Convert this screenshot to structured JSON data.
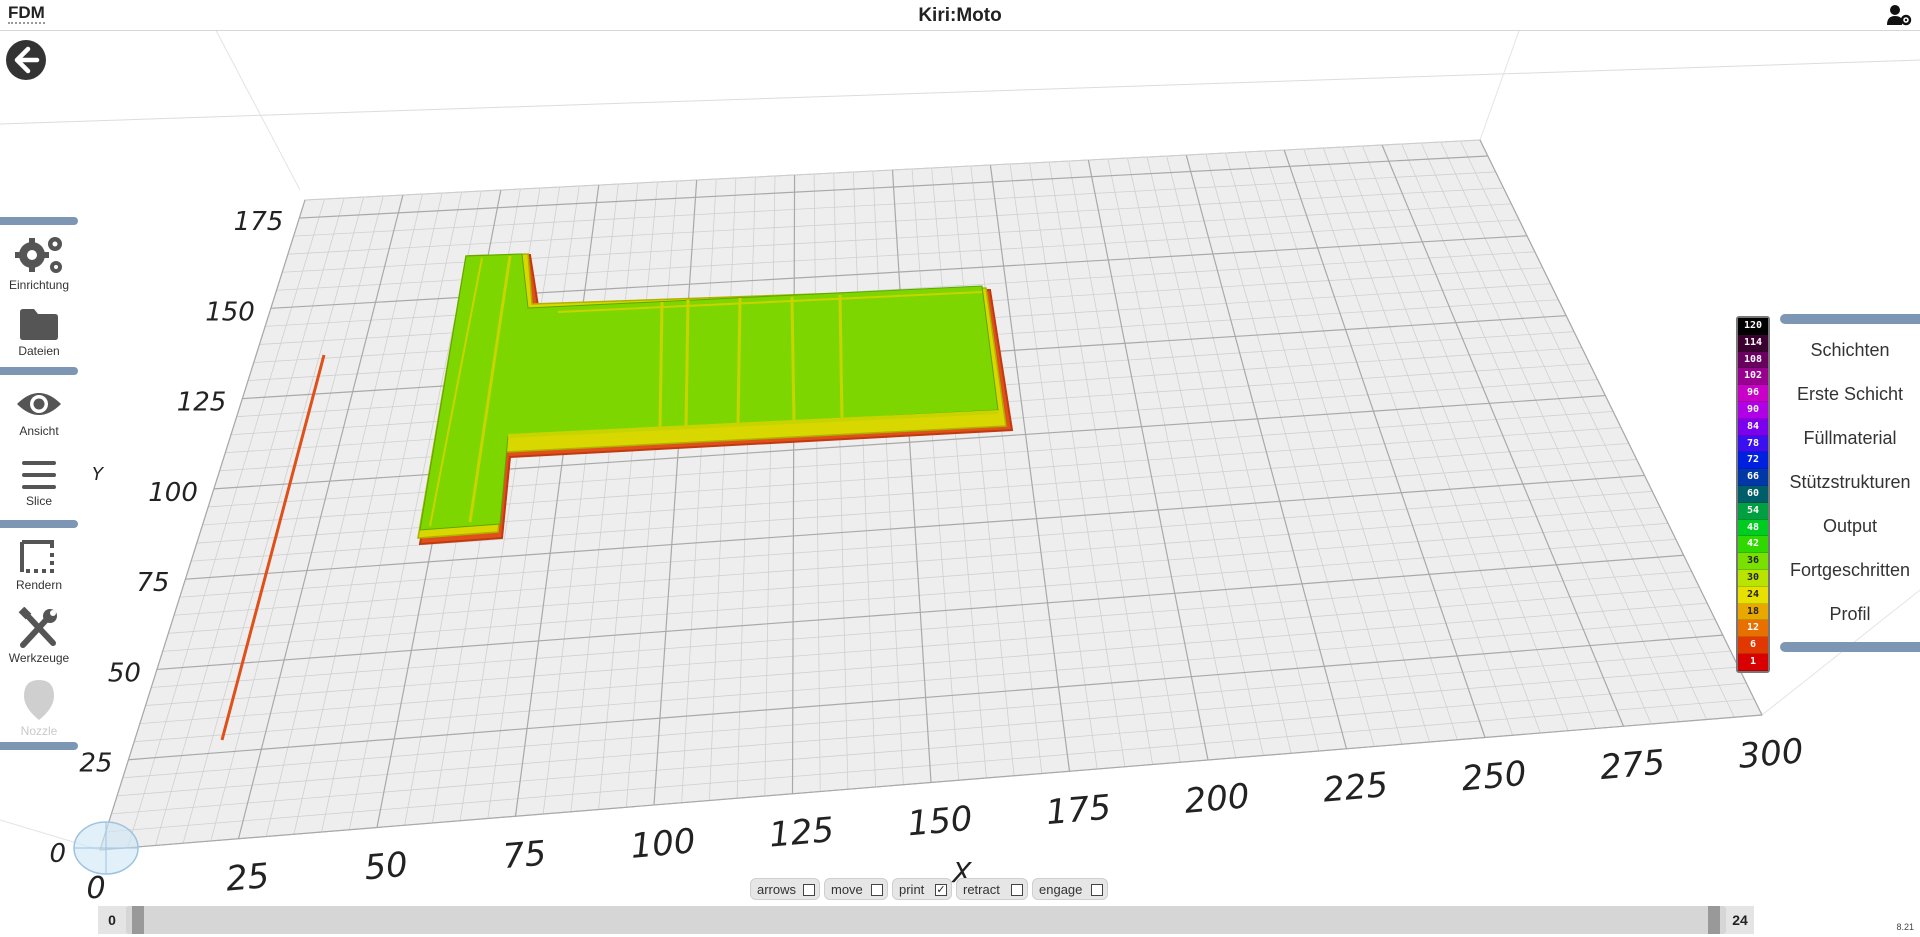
{
  "header": {
    "mode": "FDM",
    "title": "Kiri:Moto"
  },
  "sidebar": {
    "items": [
      {
        "label": "Einrichtung",
        "icon": "gears-icon"
      },
      {
        "label": "Dateien",
        "icon": "folder-icon"
      },
      {
        "label": "Ansicht",
        "icon": "eye-icon"
      },
      {
        "label": "Slice",
        "icon": "menu-icon"
      },
      {
        "label": "Rendern",
        "icon": "render-icon"
      },
      {
        "label": "Werkzeuge",
        "icon": "tools-icon"
      },
      {
        "label": "Nozzle",
        "icon": "nozzle-icon",
        "disabled": true
      }
    ]
  },
  "right_panel": {
    "items": [
      "Schichten",
      "Erste Schicht",
      "Füllmaterial",
      "Stützstrukturen",
      "Output",
      "Fortgeschritten",
      "Profil"
    ]
  },
  "legend": {
    "entries": [
      {
        "value": "120",
        "color": "#000000"
      },
      {
        "value": "114",
        "color": "#3a0030"
      },
      {
        "value": "108",
        "color": "#6a0060"
      },
      {
        "value": "102",
        "color": "#9a0090"
      },
      {
        "value": "96",
        "color": "#c800c8"
      },
      {
        "value": "90",
        "color": "#b000e6"
      },
      {
        "value": "84",
        "color": "#7a00ee"
      },
      {
        "value": "78",
        "color": "#3a10f0"
      },
      {
        "value": "72",
        "color": "#0020e0"
      },
      {
        "value": "66",
        "color": "#0038a8"
      },
      {
        "value": "60",
        "color": "#005e6a"
      },
      {
        "value": "54",
        "color": "#00a040"
      },
      {
        "value": "48",
        "color": "#00cc20"
      },
      {
        "value": "42",
        "color": "#30d800"
      },
      {
        "value": "36",
        "color": "#7ae000"
      },
      {
        "value": "30",
        "color": "#b8e400"
      },
      {
        "value": "24",
        "color": "#e8e000"
      },
      {
        "value": "18",
        "color": "#e8a800"
      },
      {
        "value": "12",
        "color": "#e87000"
      },
      {
        "value": "6",
        "color": "#e03800"
      },
      {
        "value": "1",
        "color": "#d80000"
      }
    ]
  },
  "axes": {
    "x_label": "X",
    "y_label": "Y",
    "x_ticks": [
      "0",
      "25",
      "50",
      "75",
      "100",
      "125",
      "150",
      "175",
      "200",
      "225",
      "250",
      "275",
      "300"
    ],
    "y_ticks": [
      "0",
      "25",
      "50",
      "75",
      "100",
      "125",
      "150",
      "175"
    ]
  },
  "view_controls": [
    {
      "label": "arrows",
      "checked": false
    },
    {
      "label": "move",
      "checked": false
    },
    {
      "label": "print",
      "checked": true
    },
    {
      "label": "retract",
      "checked": false
    },
    {
      "label": "engage",
      "checked": false
    }
  ],
  "layer_slider": {
    "min_label": "0",
    "max_label": "24"
  },
  "version": "8.21",
  "colors": {
    "accent": "#7c96b4",
    "part_top": "#7ed600",
    "part_edge": "#d8d800",
    "skirt": "#e0501a"
  }
}
